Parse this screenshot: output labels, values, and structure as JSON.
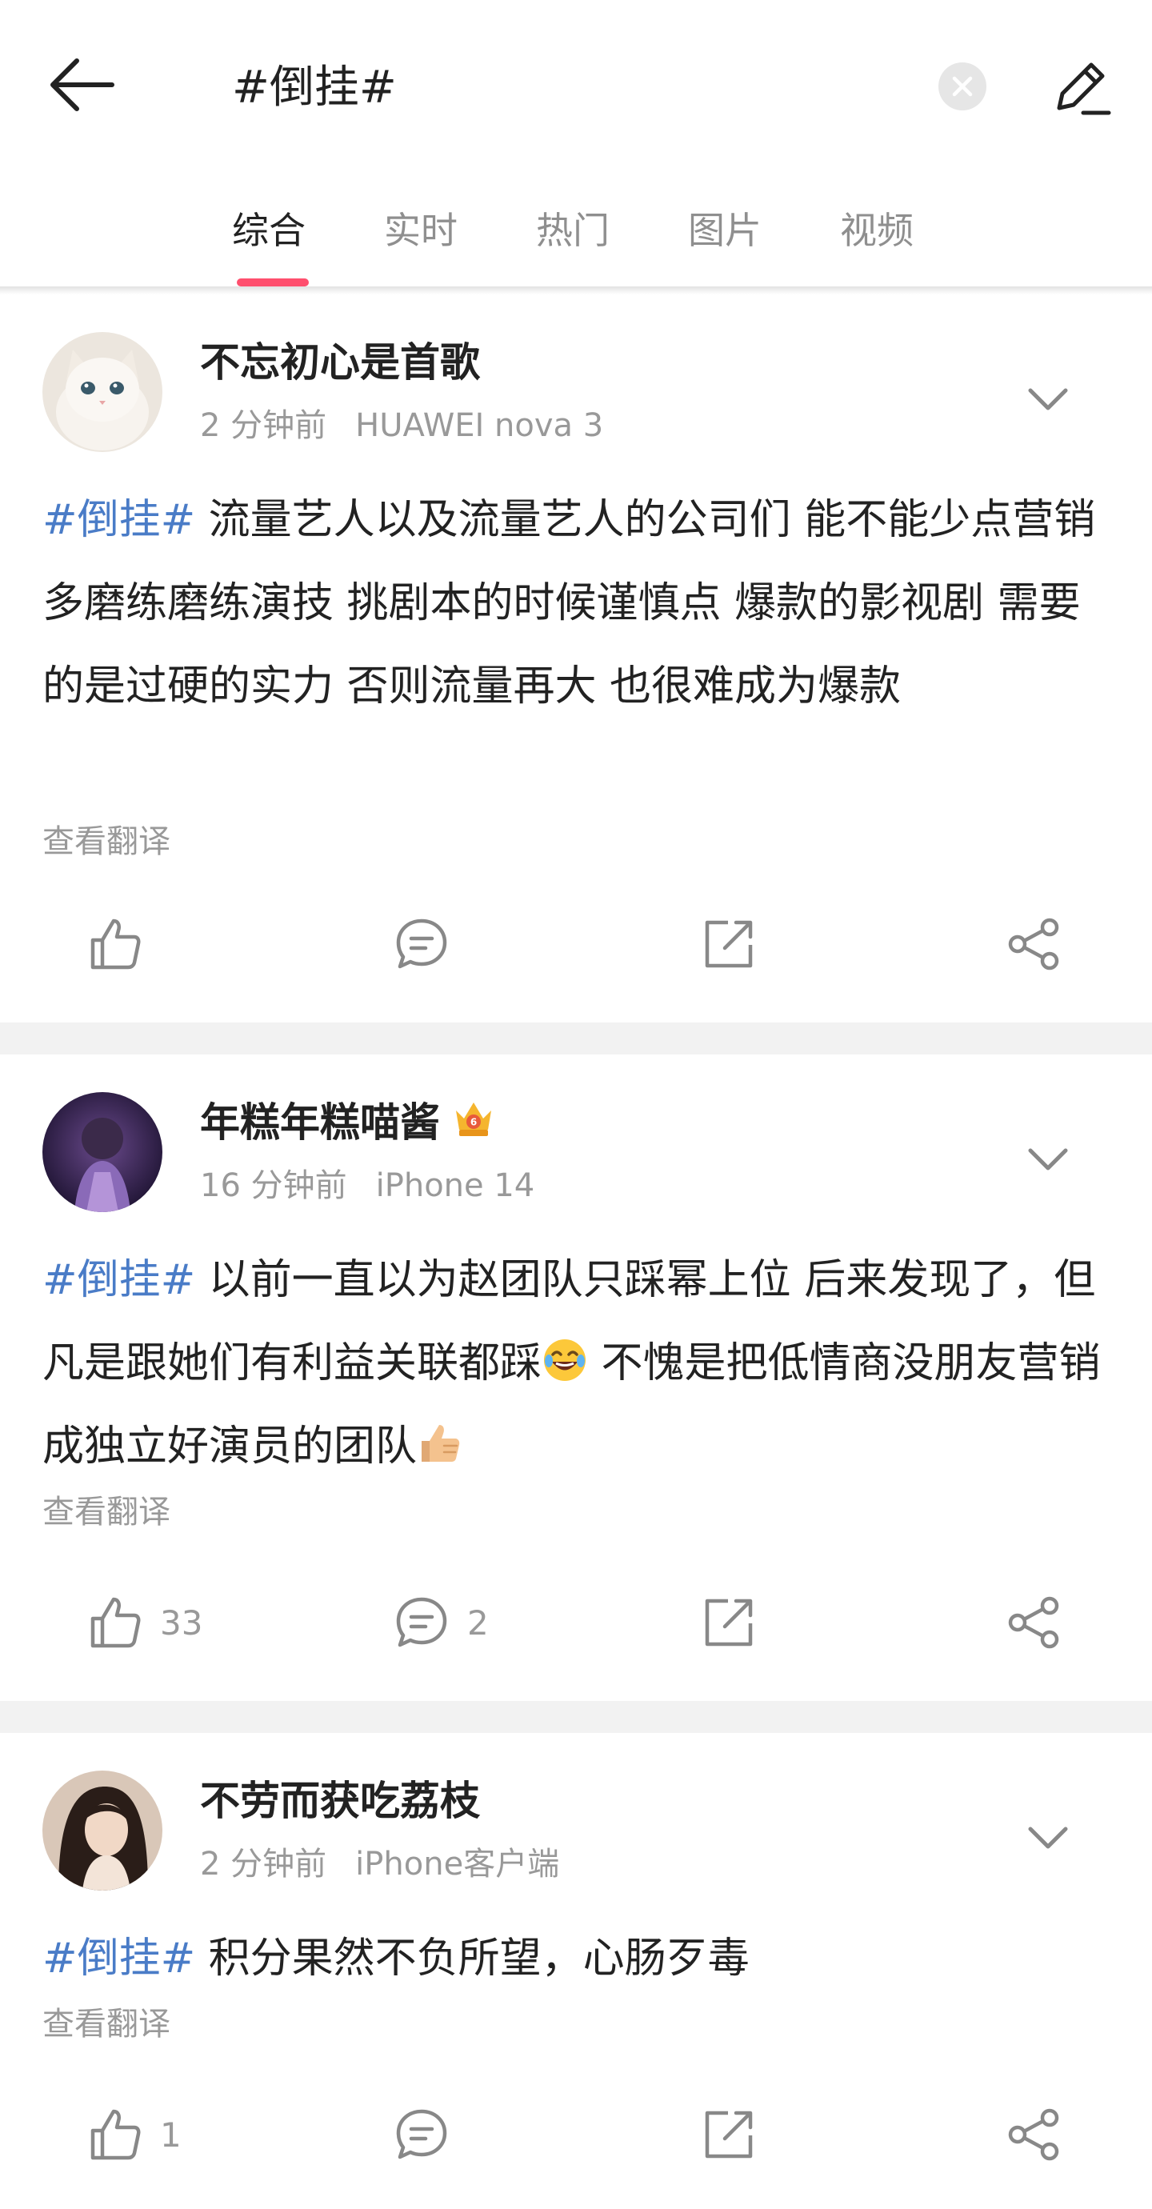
{
  "header": {
    "back_icon": "back-arrow-icon",
    "search_query": "#倒挂#",
    "clear_icon": "close-icon",
    "edit_icon": "edit-pencil-icon"
  },
  "tabs": [
    {
      "label": "综合",
      "active": true
    },
    {
      "label": "实时",
      "active": false
    },
    {
      "label": "热门",
      "active": false
    },
    {
      "label": "图片",
      "active": false
    },
    {
      "label": "视频",
      "active": false
    }
  ],
  "posts": [
    {
      "username": "不忘初心是首歌",
      "badge": null,
      "time": "2 分钟前",
      "device": "HUAWEI nova 3",
      "hashtag": "#倒挂#",
      "text": " 流量艺人以及流量艺人的公司们 能不能少点营销 多磨练磨练演技 挑剧本的时候谨慎点 爆款的影视剧 需要的是过硬的实力 否则流量再大 也很难成为爆款",
      "translate": "查看翻译",
      "likes": "",
      "comments": ""
    },
    {
      "username": "年糕年糕喵酱",
      "badge": "crown-level-6-icon",
      "time": "16 分钟前",
      "device": "iPhone 14",
      "hashtag": "#倒挂#",
      "text_a": " 以前一直以为赵团队只踩幂上位 后来发现了，但凡是跟她们有利益关联都踩",
      "text_b": " 不愧是把低情商没朋友营销成独立好演员的团队",
      "translate": "查看翻译",
      "likes": "33",
      "comments": "2"
    },
    {
      "username": "不劳而获吃荔枝",
      "badge": null,
      "time": "2 分钟前",
      "device": "iPhone客户端",
      "hashtag": "#倒挂#",
      "text": " 积分果然不负所望，心肠歹毒",
      "translate": "查看翻译",
      "likes": "1",
      "comments": ""
    }
  ],
  "colors": {
    "accent": "#ff4f6e",
    "hashtag": "#4a7cc7",
    "muted": "#999999",
    "divider": "#f2f2f2"
  }
}
